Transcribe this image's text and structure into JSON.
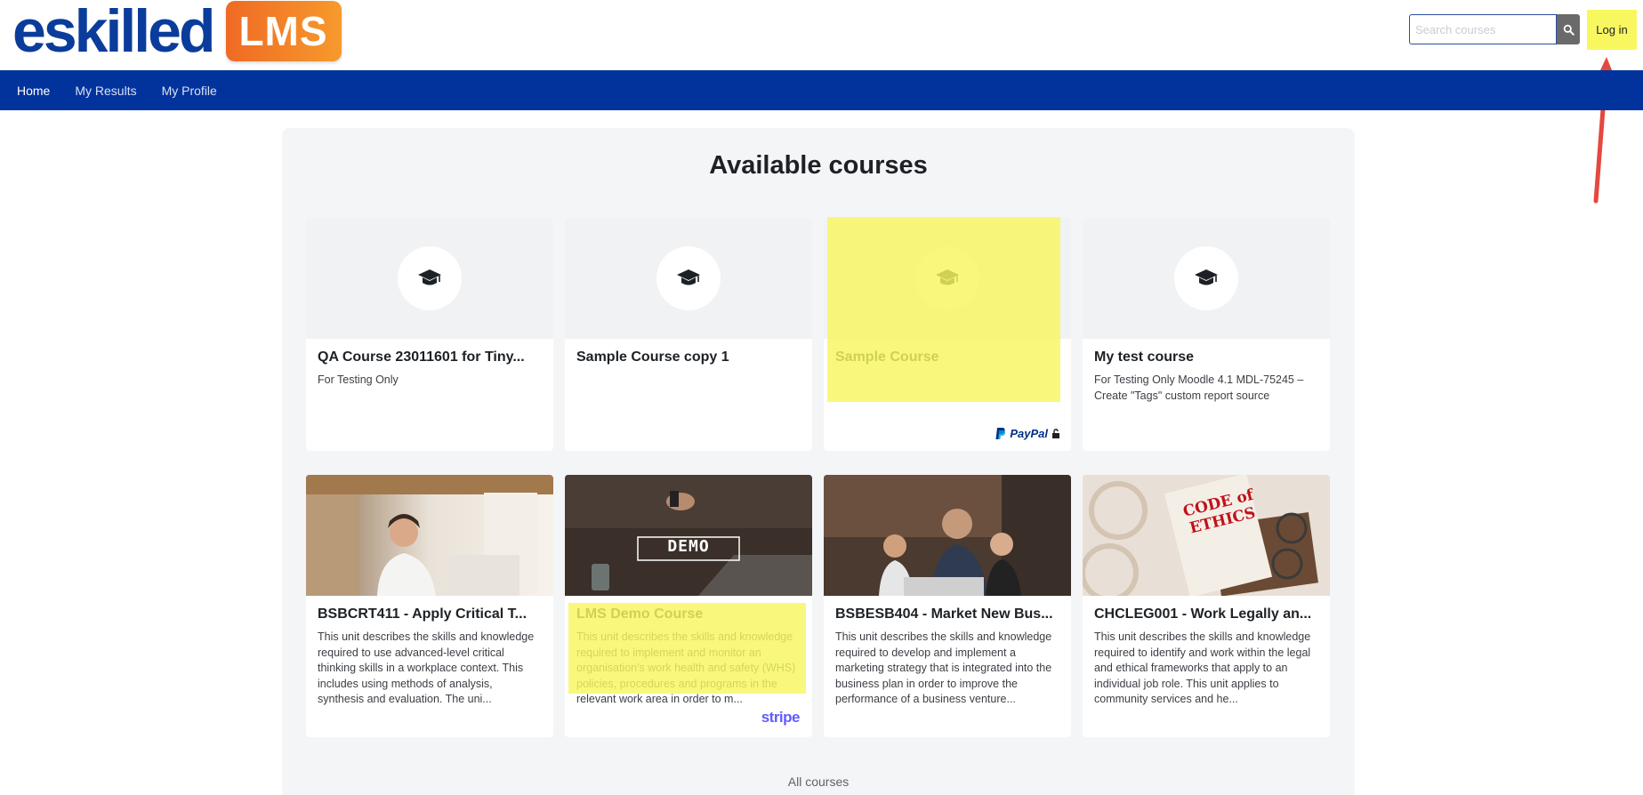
{
  "header": {
    "logo_text": "eskilled",
    "logo_badge": "LMS",
    "search": {
      "placeholder": "Search courses",
      "value": ""
    },
    "login_label": "Log in",
    "accent_color": "#f8f760",
    "arrow_color": "#e5483f"
  },
  "nav": {
    "items": [
      {
        "label": "Home",
        "active": true
      },
      {
        "label": "My Results",
        "active": false
      },
      {
        "label": "My Profile",
        "active": false
      }
    ],
    "bg_color": "#02339d"
  },
  "main": {
    "title": "Available courses",
    "courses_row1": [
      {
        "title": "QA Course 23011601 for Tiny...",
        "description": "For Testing Only",
        "icon": "graduation-cap-icon",
        "payment": ""
      },
      {
        "title": "Sample Course copy 1",
        "description": "",
        "icon": "graduation-cap-icon",
        "payment": ""
      },
      {
        "title": "Sample Course",
        "description": "",
        "icon": "graduation-cap-icon",
        "payment": "PayPal"
      },
      {
        "title": "My test course",
        "description": "For Testing Only Moodle 4.1 MDL-75245 – Create \"Tags\" custom report source",
        "icon": "graduation-cap-icon",
        "payment": ""
      }
    ],
    "courses_row2": [
      {
        "title": "BSBCRT411 - Apply Critical T...",
        "description": "This unit describes the skills and knowledge required to use advanced-level critical thinking skills in a workplace context. This includes using methods of analysis, synthesis and evaluation. The uni...",
        "image": "man-thinking-photo",
        "payment": ""
      },
      {
        "title": "LMS Demo Course",
        "description": "This unit describes the skills and knowledge required to implement and monitor an organisation's work health and safety (WHS) policies, procedures and programs in the relevant work area in order to m...",
        "image": "demo-laptop-photo",
        "image_text": "DEMO",
        "payment": "stripe"
      },
      {
        "title": "BSBESB404 - Market New Bus...",
        "description": "This unit describes the skills and knowledge required to develop and implement a marketing strategy that is integrated into the business plan in order to improve the performance of a business venture...",
        "image": "team-meeting-photo",
        "payment": ""
      },
      {
        "title": "CHCLEG001 - Work Legally an...",
        "description": "This unit describes the skills and knowledge required to identify and work within the legal and ethical frameworks that apply to an individual job role. This unit applies to community services and he...",
        "image": "code-of-ethics-photo",
        "image_text": "CODE of ETHICS",
        "payment": ""
      }
    ],
    "all_courses_link": "All courses"
  }
}
